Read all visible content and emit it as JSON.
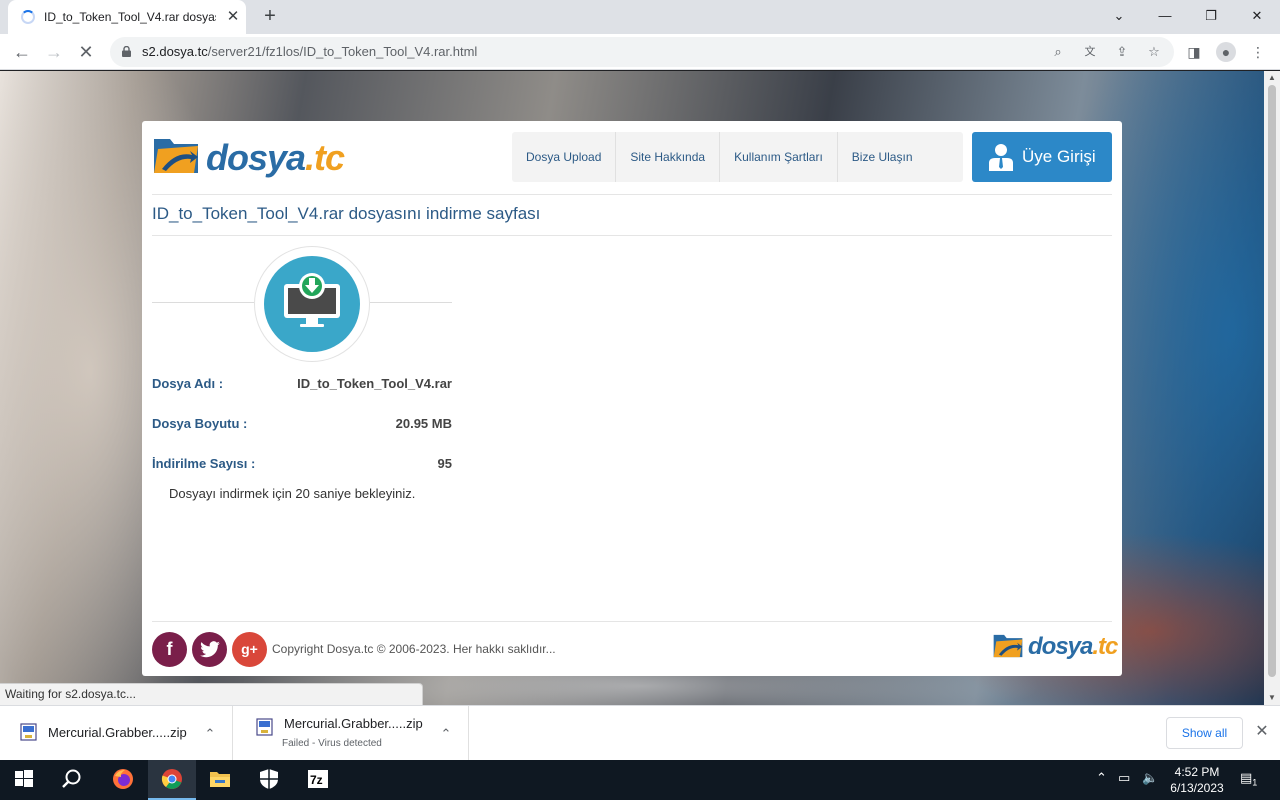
{
  "browser": {
    "tab_title": "ID_to_Token_Tool_V4.rar dosyasını",
    "tab_close": "✕",
    "new_tab": "+",
    "url_host": "s2.dosya.tc",
    "url_path": "/server21/fz1los/ID_to_Token_Tool_V4.rar.html",
    "status_text": "Waiting for s2.dosya.tc..."
  },
  "page": {
    "logo_text": "dosya",
    "logo_tld": ".tc",
    "nav": [
      "Dosya Upload",
      "Site Hakkında",
      "Kullanım Şartları",
      "Bize Ulaşın"
    ],
    "login_label": "Üye Girişi",
    "title": "ID_to_Token_Tool_V4.rar dosyasını indirme sayfası",
    "file_name_label": "Dosya Adı :",
    "file_name": "ID_to_Token_Tool_V4.rar",
    "file_size_label": "Dosya Boyutu :",
    "file_size": "20.95 MB",
    "download_count_label": "İndirilme Sayısı :",
    "download_count": "95",
    "wait_message": "Dosyayı indirmek için 20 saniye bekleyiniz.",
    "copyright": "Copyright Dosya.tc © 2006-2023. Her hakkı saklıdır...",
    "social": [
      "facebook-icon",
      "twitter-icon",
      "google-plus-icon"
    ],
    "google_plus_label": "g+"
  },
  "downloads": [
    {
      "name": "Mercurial.Grabber.....zip",
      "status": ""
    },
    {
      "name": "Mercurial.Grabber.....zip",
      "status": "Failed - Virus detected"
    }
  ],
  "shelf": {
    "show_all": "Show all"
  },
  "taskbar": {
    "apps": [
      "start-icon",
      "search-icon",
      "firefox-icon",
      "chrome-icon",
      "file-explorer-icon",
      "security-icon",
      "7zip-icon"
    ],
    "time": "4:52 PM",
    "date": "6/13/2023",
    "notification_count": "1"
  },
  "colors": {
    "brand_blue": "#2c5a86",
    "button_blue": "#2c88c8",
    "download_teal": "#3aa7c9",
    "social_purple": "#7a1f4a",
    "gplus_red": "#d9473a"
  }
}
